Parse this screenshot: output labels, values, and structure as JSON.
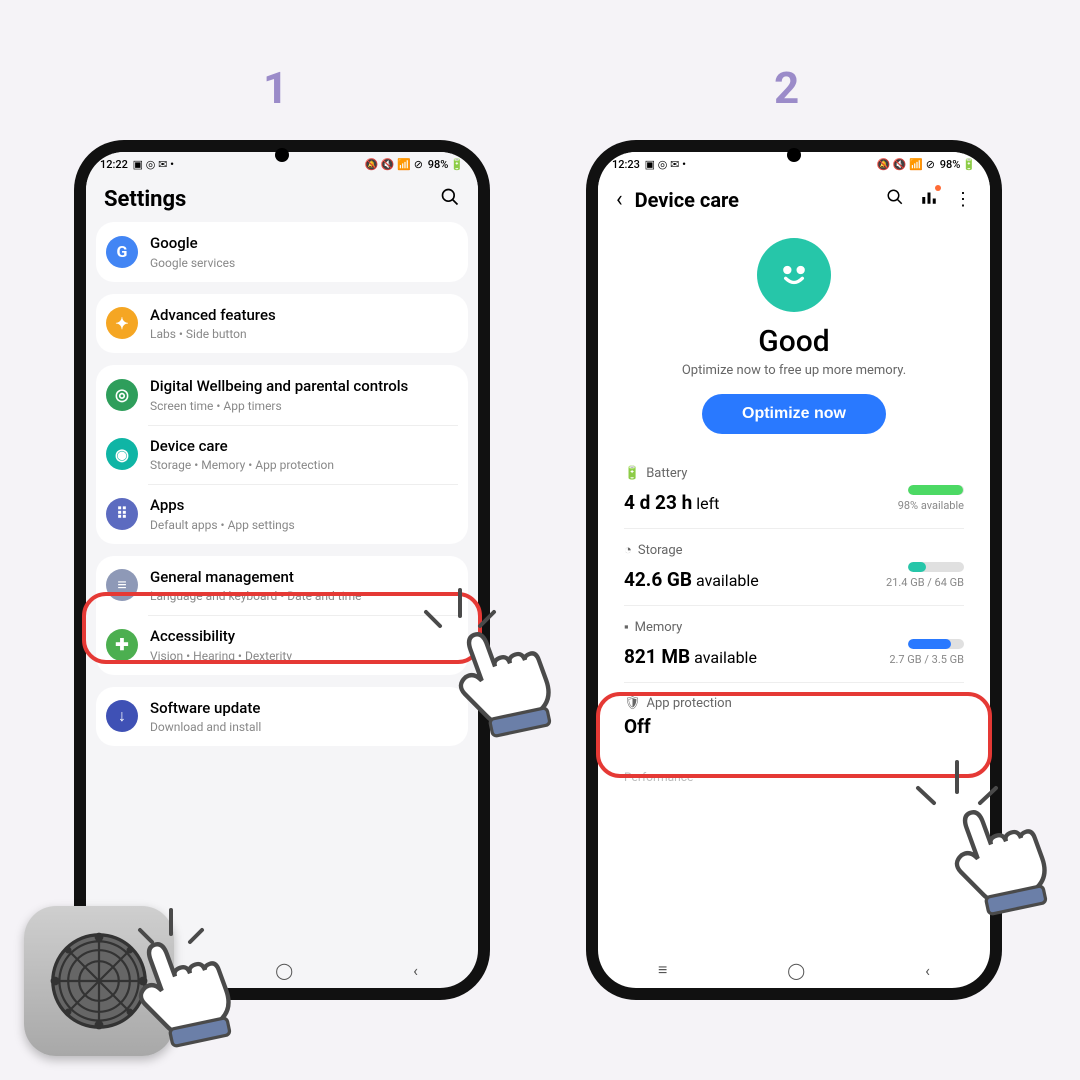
{
  "steps": {
    "one": "1",
    "two": "2"
  },
  "phone1": {
    "status_time": "12:22",
    "status_right": "98%",
    "title": "Settings",
    "items": {
      "google": {
        "title": "Google",
        "sub": "Google services",
        "color": "#4285f4",
        "glyph": "G"
      },
      "advanced": {
        "title": "Advanced features",
        "sub": "Labs  •  Side button",
        "color": "#f5a623",
        "glyph": "✦"
      },
      "wellbeing": {
        "title": "Digital Wellbeing and parental controls",
        "sub": "Screen time  •  App timers",
        "color": "#2e9e5b",
        "glyph": "◎"
      },
      "devcare": {
        "title": "Device care",
        "sub": "Storage  •  Memory  •  App protection",
        "color": "#0fb5a5",
        "glyph": "◉"
      },
      "apps": {
        "title": "Apps",
        "sub": "Default apps  •  App settings",
        "color": "#5c6bc0",
        "glyph": "⠿"
      },
      "general": {
        "title": "General management",
        "sub": "Language and keyboard  •  Date and time",
        "color": "#8e99b7",
        "glyph": "≡"
      },
      "access": {
        "title": "Accessibility",
        "sub": "Vision  •  Hearing  •  Dexterity",
        "color": "#4caf50",
        "glyph": "✚"
      },
      "update": {
        "title": "Software update",
        "sub": "Download and install",
        "color": "#3f51b5",
        "glyph": "↓"
      }
    }
  },
  "phone2": {
    "status_time": "12:23",
    "status_right": "98%",
    "title": "Device care",
    "status_heading": "Good",
    "status_sub": "Optimize now to free up more memory.",
    "optimize_btn": "Optimize now",
    "battery": {
      "label": "Battery",
      "value": "4 d 23 h",
      "unit": "left",
      "note": "98% available",
      "fill_pct": 98,
      "color": "#4cd964"
    },
    "storage": {
      "label": "Storage",
      "value": "42.6 GB",
      "unit": "available",
      "note": "21.4 GB / 64 GB",
      "fill_pct": 33,
      "color": "#26c6a9"
    },
    "memory": {
      "label": "Memory",
      "value": "821 MB",
      "unit": "available",
      "note": "2.7 GB / 3.5 GB",
      "fill_pct": 77,
      "color": "#2979ff"
    },
    "appprot": {
      "label": "App protection",
      "value": "Off"
    },
    "performance": "Performance"
  }
}
